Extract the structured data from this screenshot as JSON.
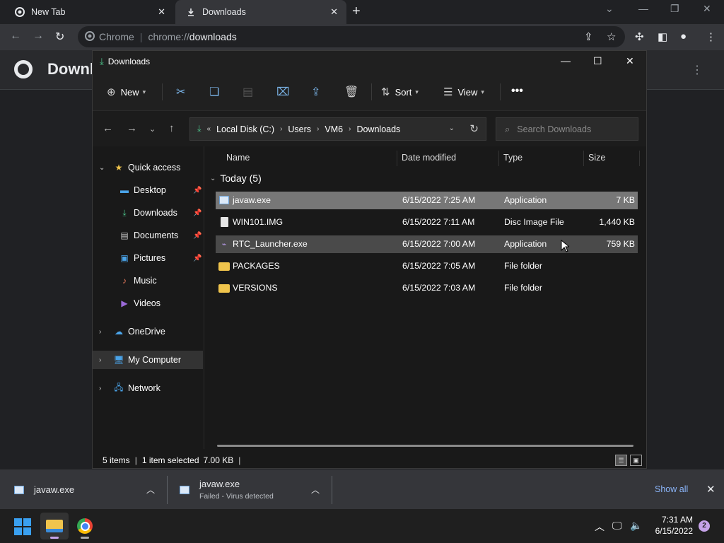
{
  "chrome": {
    "tabs": [
      {
        "label": "New Tab"
      },
      {
        "label": "Downloads"
      }
    ],
    "omnibox": {
      "site_label": "Chrome",
      "url_scheme": "chrome://",
      "url_host": "downloads"
    },
    "page_title": "Downloads"
  },
  "explorer": {
    "title": "Downloads",
    "commands": {
      "new": "New",
      "sort": "Sort",
      "view": "View"
    },
    "breadcrumb": [
      "Local Disk (C:)",
      "Users",
      "VM6",
      "Downloads"
    ],
    "search_placeholder": "Search Downloads",
    "nav": {
      "quick_access": "Quick access",
      "items": [
        {
          "label": "Desktop",
          "icon": "desktop-icon",
          "pinned": true
        },
        {
          "label": "Downloads",
          "icon": "downloads-icon",
          "pinned": true
        },
        {
          "label": "Documents",
          "icon": "documents-icon",
          "pinned": true
        },
        {
          "label": "Pictures",
          "icon": "pictures-icon",
          "pinned": true
        },
        {
          "label": "Music",
          "icon": "music-icon",
          "pinned": false
        },
        {
          "label": "Videos",
          "icon": "videos-icon",
          "pinned": false
        }
      ],
      "onedrive": "OneDrive",
      "my_computer": "My Computer",
      "network": "Network"
    },
    "columns": {
      "name": "Name",
      "date": "Date modified",
      "type": "Type",
      "size": "Size"
    },
    "group_label": "Today (5)",
    "files": [
      {
        "name": "javaw.exe",
        "date": "6/15/2022 7:25 AM",
        "type": "Application",
        "size": "7 KB",
        "icon": "application-icon"
      },
      {
        "name": "WIN101.IMG",
        "date": "6/15/2022 7:11 AM",
        "type": "Disc Image File",
        "size": "1,440 KB",
        "icon": "disc-image-icon"
      },
      {
        "name": "RTC_Launcher.exe",
        "date": "6/15/2022 7:00 AM",
        "type": "Application",
        "size": "759 KB",
        "icon": "launcher-icon"
      },
      {
        "name": "PACKAGES",
        "date": "6/15/2022 7:05 AM",
        "type": "File folder",
        "size": "",
        "icon": "folder-icon"
      },
      {
        "name": "VERSIONS",
        "date": "6/15/2022 7:03 AM",
        "type": "File folder",
        "size": "",
        "icon": "folder-icon"
      }
    ],
    "status": {
      "count": "5 items",
      "selected": "1 item selected",
      "size": "7.00 KB"
    }
  },
  "shelf": {
    "items": [
      {
        "name": "javaw.exe",
        "status": ""
      },
      {
        "name": "javaw.exe",
        "status": "Failed - Virus detected"
      }
    ],
    "show_all": "Show all"
  },
  "taskbar": {
    "time": "7:31 AM",
    "date": "6/15/2022",
    "notifications": "2"
  }
}
